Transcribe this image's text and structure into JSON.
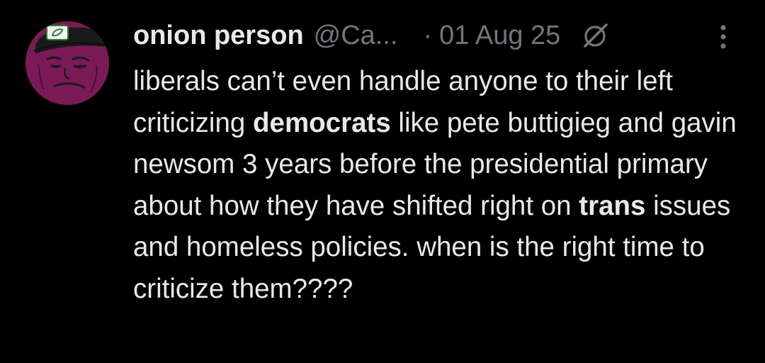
{
  "post": {
    "author": {
      "display_name": "onion person",
      "handle": "@Ca...",
      "avatar_icon": "onion-character-avatar"
    },
    "separator": "·",
    "date": "01 Aug 25",
    "header_icon": "grok-icon",
    "menu_icon": "more-vertical-icon",
    "text_segments": [
      "liberals can’t even handle anyone to their left criticizing ",
      "democrats",
      " like pete buttigieg and gavin newsom 3 years before the presidential primary about how they have shifted right on ",
      "trans",
      " issues and homeless policies.  when is the right time to criticize them????"
    ],
    "colors": {
      "background": "#000000",
      "primary_text": "#e7e9ea",
      "secondary_text": "#71767b",
      "avatar_bg": "#7a1a57"
    }
  }
}
